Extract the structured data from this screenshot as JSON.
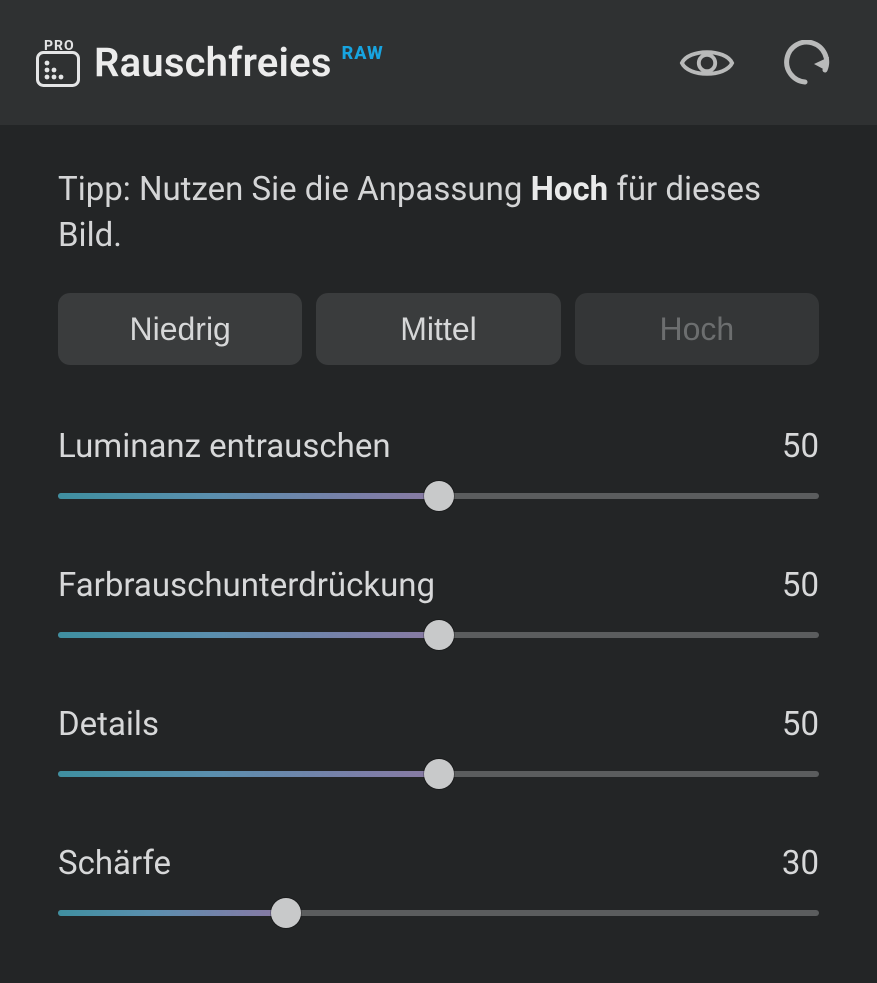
{
  "header": {
    "pro_label": "PRO",
    "title": "Rauschfreies",
    "raw_badge": "RAW"
  },
  "tip": {
    "prefix": "Tipp: Nutzen Sie die Anpassung ",
    "bold": "Hoch",
    "suffix": " für dieses Bild."
  },
  "presets": {
    "low": "Niedrig",
    "mid": "Mittel",
    "high": "Hoch"
  },
  "sliders": {
    "luminance": {
      "label": "Luminanz entrauschen",
      "value": 50
    },
    "color": {
      "label": "Farbrauschunterdrückung",
      "value": 50
    },
    "details": {
      "label": "Details",
      "value": 50
    },
    "sharpen": {
      "label": "Schärfe",
      "value": 30
    }
  }
}
